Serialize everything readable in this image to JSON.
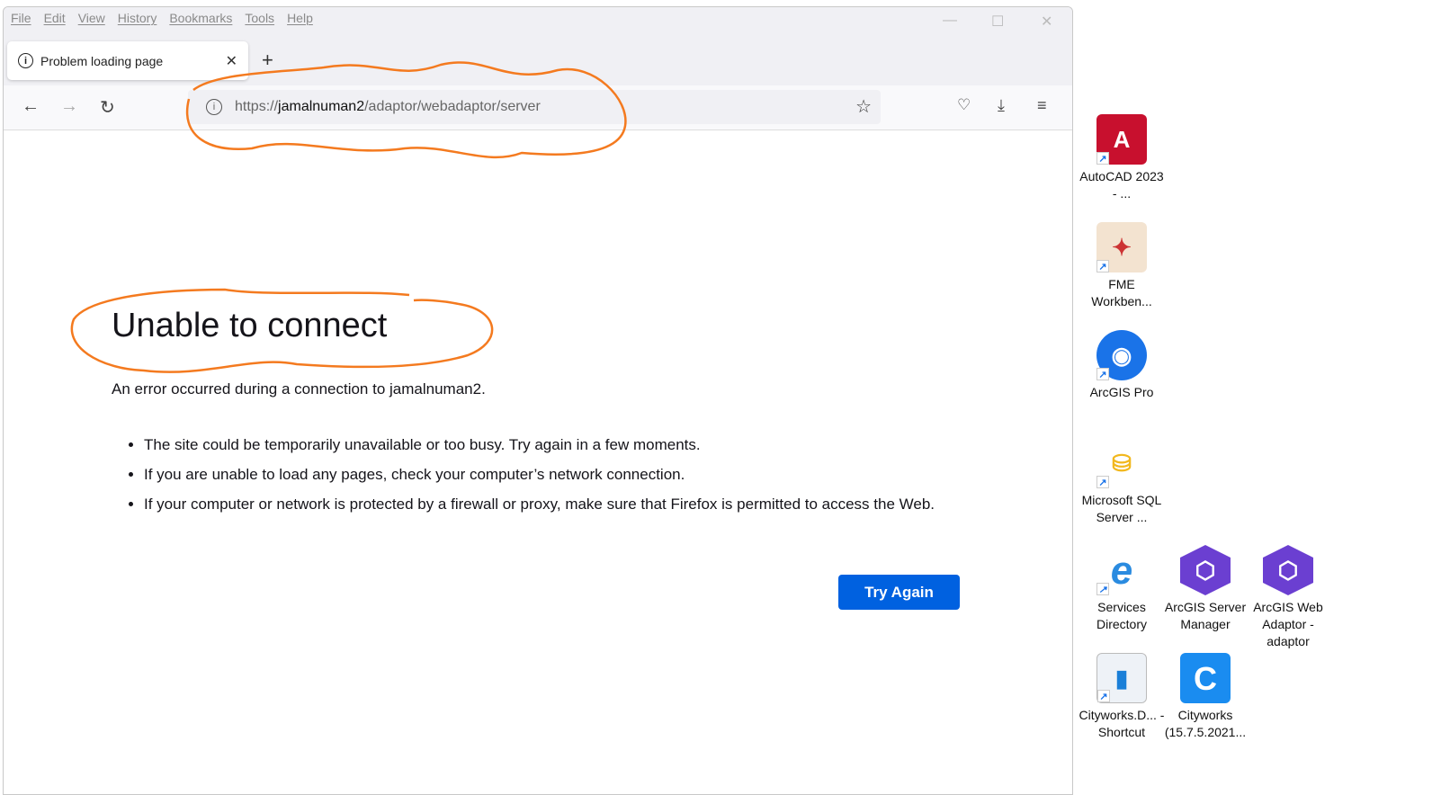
{
  "menu": [
    "File",
    "Edit",
    "View",
    "History",
    "Bookmarks",
    "Tools",
    "Help"
  ],
  "tab": {
    "title": "Problem loading page"
  },
  "url": {
    "scheme": "https://",
    "host": "jamalnuman2",
    "path": "/adaptor/webadaptor/server"
  },
  "error": {
    "title": "Unable to connect",
    "subtitle": "An error occurred during a connection to jamalnuman2.",
    "bullets": [
      "The site could be temporarily unavailable or too busy. Try again in a few moments.",
      "If you are unable to load any pages, check your computer’s network connection.",
      "If your computer or network is protected by a firewall or proxy, make sure that Firefox is permitted to access the Web."
    ],
    "try_again": "Try Again"
  },
  "desktop": [
    {
      "label": "AutoCAD 2023 - ...",
      "glyph": "A",
      "color": "#c8102e"
    },
    {
      "label": "FME Workben...",
      "glyph": "✦",
      "color": "#e0e0e0"
    },
    {
      "label": "ArcGIS Pro",
      "glyph": "◉",
      "color": "#1a73e8"
    },
    {
      "label": "Microsoft SQL Server ...",
      "glyph": "⛁",
      "color": "#f2c12e"
    },
    {
      "label": "Services Directory",
      "glyph": "e",
      "color": "#2a8be0"
    },
    {
      "label": "ArcGIS Server Manager",
      "glyph": "⬡",
      "color": "#6b3fd1"
    },
    {
      "label": "ArcGIS Web Adaptor - adaptor",
      "glyph": "⬡",
      "color": "#6b3fd1"
    },
    {
      "label": "Cityworks.D... - Shortcut",
      "glyph": "▮",
      "color": "#d8e6f5"
    },
    {
      "label": "Cityworks (15.7.5.2021...",
      "glyph": "C",
      "color": "#1a8cf0"
    }
  ]
}
